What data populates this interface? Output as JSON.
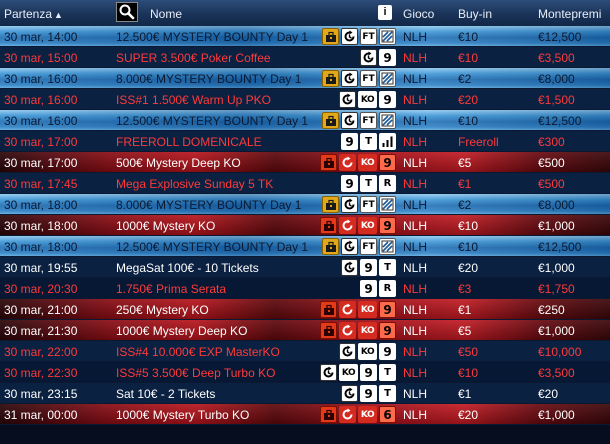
{
  "header": {
    "partenza": "Partenza",
    "sort_arrow": "▲",
    "nome": "Nome",
    "info": "i",
    "gioco": "Gioco",
    "buyin": "Buy-in",
    "montepremi": "Montepremi"
  },
  "colors": {
    "blue_row": "#2a7fc4",
    "red_row": "#b8141c",
    "plain_row": "#071834",
    "red_text": "#ff3a3a"
  },
  "rows": [
    {
      "style": "blue",
      "date": "30 mar, 14:00",
      "name": "12.500€ MYSTERY BOUNTY Day 1",
      "icons": [
        "bounty-gold",
        "late",
        "FT",
        "speed"
      ],
      "gioco": "NLH",
      "buyin": "€10",
      "monte": "€12,500",
      "color": "dark"
    },
    {
      "style": "plain",
      "date": "30 mar, 15:00",
      "name": "SUPER 3.500€ Poker Coffee",
      "icons": [
        "late",
        "9"
      ],
      "gioco": "NLH",
      "buyin": "€10",
      "monte": "€3,500",
      "color": "red"
    },
    {
      "style": "blue",
      "date": "30 mar, 16:00",
      "name": "8.000€ MYSTERY BOUNTY Day 1",
      "icons": [
        "bounty-gold",
        "late",
        "FT",
        "speed"
      ],
      "gioco": "NLH",
      "buyin": "€2",
      "monte": "€8,000",
      "color": "dark"
    },
    {
      "style": "plain",
      "date": "30 mar, 16:00",
      "name": "ISS#1 1.500€ Warm Up PKO",
      "icons": [
        "late",
        "KO",
        "9"
      ],
      "gioco": "NLH",
      "buyin": "€20",
      "monte": "€1,500",
      "color": "red"
    },
    {
      "style": "blue",
      "date": "30 mar, 16:00",
      "name": "12.500€ MYSTERY BOUNTY Day 1",
      "icons": [
        "bounty-gold",
        "late",
        "FT",
        "speed"
      ],
      "gioco": "NLH",
      "buyin": "€10",
      "monte": "€12,500",
      "color": "dark"
    },
    {
      "style": "plain",
      "date": "30 mar, 17:00",
      "name": "FREEROLL DOMENICALE",
      "icons": [
        "9",
        "T",
        "bars"
      ],
      "gioco": "NLH",
      "buyin": "Freeroll",
      "monte": "€300",
      "color": "red"
    },
    {
      "style": "red",
      "date": "30 mar, 17:00",
      "name": "500€ Mystery Deep KO",
      "icons": [
        "bounty-red",
        "late-red",
        "KO-red",
        "9-red"
      ],
      "gioco": "NLH",
      "buyin": "€5",
      "monte": "€500",
      "color": "white"
    },
    {
      "style": "plain",
      "date": "30 mar, 17:45",
      "name": "Mega Explosive Sunday 5 TK",
      "icons": [
        "9",
        "T",
        "R"
      ],
      "gioco": "NLH",
      "buyin": "€1",
      "monte": "€500",
      "color": "red"
    },
    {
      "style": "blue",
      "date": "30 mar, 18:00",
      "name": "8.000€ MYSTERY BOUNTY Day 1",
      "icons": [
        "bounty-gold",
        "late",
        "FT",
        "speed"
      ],
      "gioco": "NLH",
      "buyin": "€2",
      "monte": "€8,000",
      "color": "dark"
    },
    {
      "style": "red",
      "date": "30 mar, 18:00",
      "name": "1000€ Mystery KO",
      "icons": [
        "bounty-red",
        "late-red",
        "KO-red",
        "9-red"
      ],
      "gioco": "NLH",
      "buyin": "€10",
      "monte": "€1,000",
      "color": "white"
    },
    {
      "style": "blue",
      "date": "30 mar, 18:00",
      "name": "12.500€ MYSTERY BOUNTY Day 1",
      "icons": [
        "bounty-gold",
        "late",
        "FT",
        "speed"
      ],
      "gioco": "NLH",
      "buyin": "€10",
      "monte": "€12,500",
      "color": "dark"
    },
    {
      "style": "plain",
      "date": "30 mar, 19:55",
      "name": "MegaSat 100€ - 10 Tickets",
      "icons": [
        "late",
        "9",
        "T"
      ],
      "gioco": "NLH",
      "buyin": "€20",
      "monte": "€1,000",
      "color": "white"
    },
    {
      "style": "plain",
      "date": "30 mar, 20:30",
      "name": "1.750€ Prima Serata",
      "icons": [
        "9",
        "R"
      ],
      "gioco": "NLH",
      "buyin": "€3",
      "monte": "€1,750",
      "color": "red"
    },
    {
      "style": "red",
      "date": "30 mar, 21:00",
      "name": "250€ Mystery KO",
      "icons": [
        "bounty-red",
        "late-red",
        "KO-red",
        "9-red"
      ],
      "gioco": "NLH",
      "buyin": "€1",
      "monte": "€250",
      "color": "white"
    },
    {
      "style": "red",
      "date": "30 mar, 21:30",
      "name": "1000€ Mystery Deep KO",
      "icons": [
        "bounty-red",
        "late-red",
        "KO-red",
        "9-red"
      ],
      "gioco": "NLH",
      "buyin": "€5",
      "monte": "€1,000",
      "color": "white"
    },
    {
      "style": "plain",
      "date": "30 mar, 22:00",
      "name": "ISS#4 10.000€ EXP MasterKO",
      "icons": [
        "late",
        "KO",
        "9"
      ],
      "gioco": "NLH",
      "buyin": "€50",
      "monte": "€10,000",
      "color": "red"
    },
    {
      "style": "plain",
      "date": "30 mar, 22:30",
      "name": "ISS#5 3.500€ Deep Turbo KO",
      "icons": [
        "late",
        "KO",
        "9",
        "T"
      ],
      "gioco": "NLH",
      "buyin": "€10",
      "monte": "€3,500",
      "color": "red"
    },
    {
      "style": "plain",
      "date": "30 mar, 23:15",
      "name": "Sat 10€ - 2 Tickets",
      "icons": [
        "late",
        "9",
        "T"
      ],
      "gioco": "NLH",
      "buyin": "€1",
      "monte": "€20",
      "color": "white"
    },
    {
      "style": "red",
      "date": "31 mar, 00:00",
      "name": "1000€ Mystery Turbo KO",
      "icons": [
        "bounty-red",
        "late-red",
        "KO-red",
        "6-red"
      ],
      "gioco": "NLH",
      "buyin": "€20",
      "monte": "€1,000",
      "color": "white"
    }
  ]
}
